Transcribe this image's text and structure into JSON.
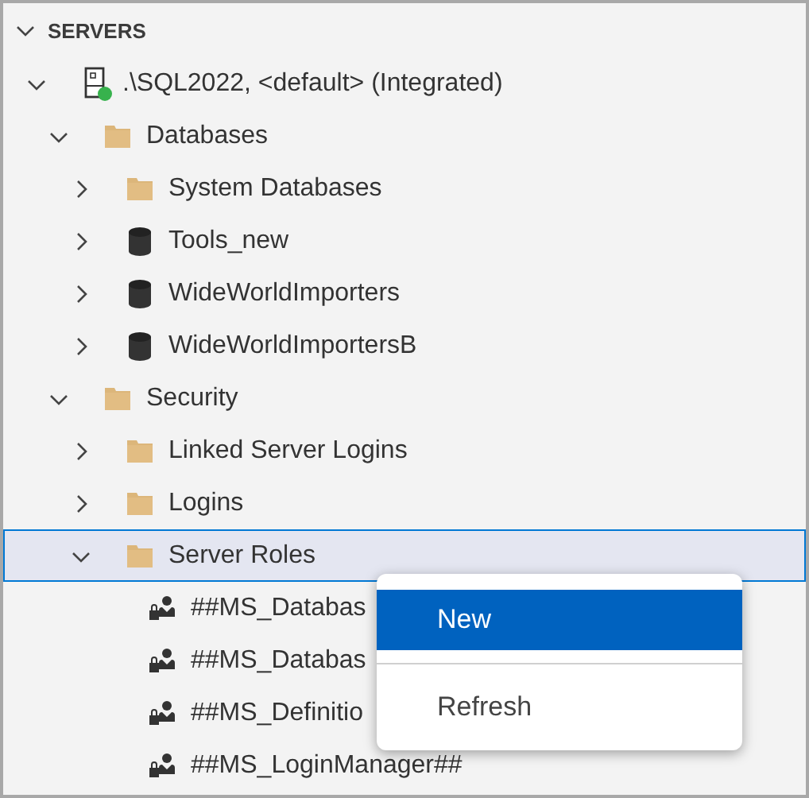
{
  "section": {
    "title": "SERVERS",
    "expanded": true
  },
  "tree": [
    {
      "kind": "server",
      "label": ".\\SQL2022, <default> (Integrated)",
      "connected": true,
      "expanded": true,
      "selected": false,
      "children": [
        {
          "kind": "folder",
          "label": "Databases",
          "expanded": true,
          "selected": false,
          "children": [
            {
              "kind": "folder",
              "label": "System Databases",
              "expanded": false,
              "selected": false
            },
            {
              "kind": "database",
              "label": "Tools_new",
              "expanded": false,
              "selected": false
            },
            {
              "kind": "database",
              "label": "WideWorldImporters",
              "expanded": false,
              "selected": false
            },
            {
              "kind": "database",
              "label": "WideWorldImportersB",
              "expanded": false,
              "selected": false
            }
          ]
        },
        {
          "kind": "folder",
          "label": "Security",
          "expanded": true,
          "selected": false,
          "children": [
            {
              "kind": "folder",
              "label": "Linked Server Logins",
              "expanded": false,
              "selected": false
            },
            {
              "kind": "folder",
              "label": "Logins",
              "expanded": false,
              "selected": false
            },
            {
              "kind": "folder",
              "label": "Server Roles",
              "expanded": true,
              "selected": true,
              "children": [
                {
                  "kind": "role",
                  "label": "##MS_Databas",
                  "selected": false
                },
                {
                  "kind": "role",
                  "label": "##MS_Databas",
                  "selected": false
                },
                {
                  "kind": "role",
                  "label": "##MS_Definitio",
                  "selected": false
                },
                {
                  "kind": "role",
                  "label": "##MS_LoginManager##",
                  "selected": false
                }
              ]
            }
          ]
        }
      ]
    }
  ],
  "context_menu": {
    "items": [
      {
        "label": "New",
        "selected": true
      },
      {
        "label": "Refresh",
        "selected": false
      }
    ]
  }
}
